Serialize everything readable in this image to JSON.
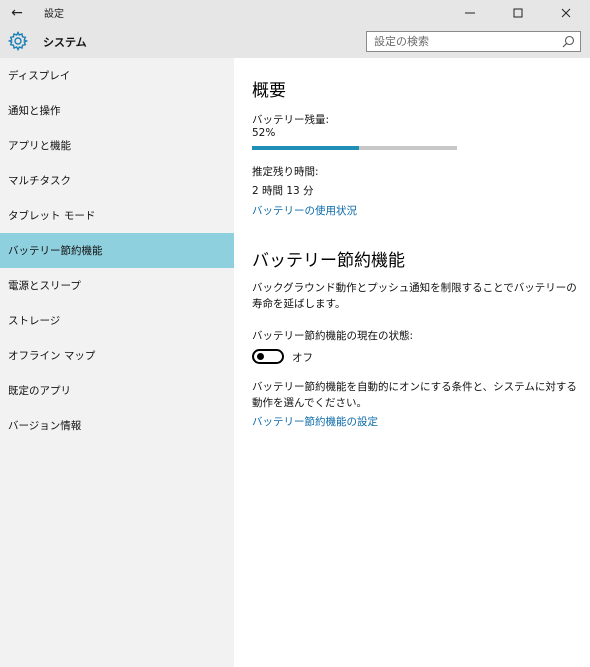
{
  "window": {
    "title": "設定"
  },
  "header": {
    "title": "システム",
    "search_placeholder": "設定の検索"
  },
  "sidebar": {
    "items": [
      {
        "label": "ディスプレイ"
      },
      {
        "label": "通知と操作"
      },
      {
        "label": "アプリと機能"
      },
      {
        "label": "マルチタスク"
      },
      {
        "label": "タブレット モード"
      },
      {
        "label": "バッテリー節約機能",
        "selected": true
      },
      {
        "label": "電源とスリープ"
      },
      {
        "label": "ストレージ"
      },
      {
        "label": "オフライン マップ"
      },
      {
        "label": "既定のアプリ"
      },
      {
        "label": "バージョン情報"
      }
    ]
  },
  "overview": {
    "heading": "概要",
    "battery_label": "バッテリー残量:",
    "battery_value": "52%",
    "battery_fraction": 0.52,
    "remaining_label": "推定残り時間:",
    "remaining_value": "2 時間 13 分",
    "usage_link": "バッテリーの使用状況"
  },
  "saver": {
    "heading": "バッテリー節約機能",
    "description": "バックグラウンド動作とプッシュ通知を制限することでバッテリーの寿命を延ばします。",
    "status_label": "バッテリー節約機能の現在の状態:",
    "toggle_text": "オフ",
    "toggle_on": false,
    "auto_description": "バッテリー節約機能を自動的にオンにする条件と、システムに対する動作を選んでください。",
    "settings_link": "バッテリー節約機能の設定"
  },
  "colors": {
    "selected_nav": "#8fd0de",
    "progress_fill": "#1f8fb8",
    "link": "#0a6aa8"
  }
}
